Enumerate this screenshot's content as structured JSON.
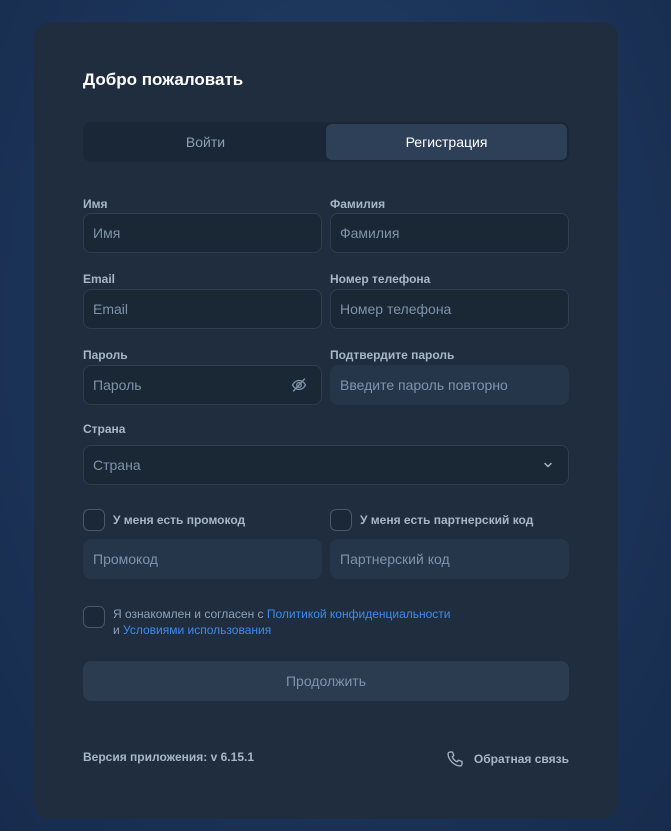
{
  "header": {
    "title": "Добро пожаловать"
  },
  "tabs": [
    {
      "label": "Войти",
      "active": false
    },
    {
      "label": "Регистрация",
      "active": true
    }
  ],
  "form": {
    "first_name": {
      "label": "Имя",
      "placeholder": "Имя"
    },
    "last_name": {
      "label": "Фамилия",
      "placeholder": "Фамилия"
    },
    "email": {
      "label": "Email",
      "placeholder": "Email"
    },
    "phone": {
      "label": "Номер телефона",
      "placeholder": "Номер телефона"
    },
    "password": {
      "label": "Пароль",
      "placeholder": "Пароль"
    },
    "confirm_password": {
      "label": "Подтвердите пароль",
      "placeholder": "Введите пароль повторно"
    },
    "country": {
      "label": "Страна",
      "value": "Страна"
    },
    "promo": {
      "checkbox_label": "У меня есть промокод",
      "placeholder": "Промокод",
      "checked": false
    },
    "partner": {
      "checkbox_label": "У меня есть партнерский код",
      "placeholder": "Партнерский код",
      "checked": false
    },
    "consent": {
      "text_before": "Я ознакомлен и согласен с ",
      "privacy_link": "Политикой конфиденциальности",
      "text_and": "и ",
      "terms_link": "Условиями использования",
      "checked": false
    },
    "submit_label": "Продолжить"
  },
  "footer": {
    "version": "Версия приложения: v 6.15.1",
    "feedback_label": "Обратная связь"
  },
  "icons": {
    "password_toggle": "eye-off-icon",
    "country_dropdown": "chevron-down-icon",
    "feedback": "phone-icon"
  },
  "colors": {
    "accent_link": "#3d8bf0",
    "card_bg": "#1f2d3e",
    "active_tab": "#2d4058"
  }
}
